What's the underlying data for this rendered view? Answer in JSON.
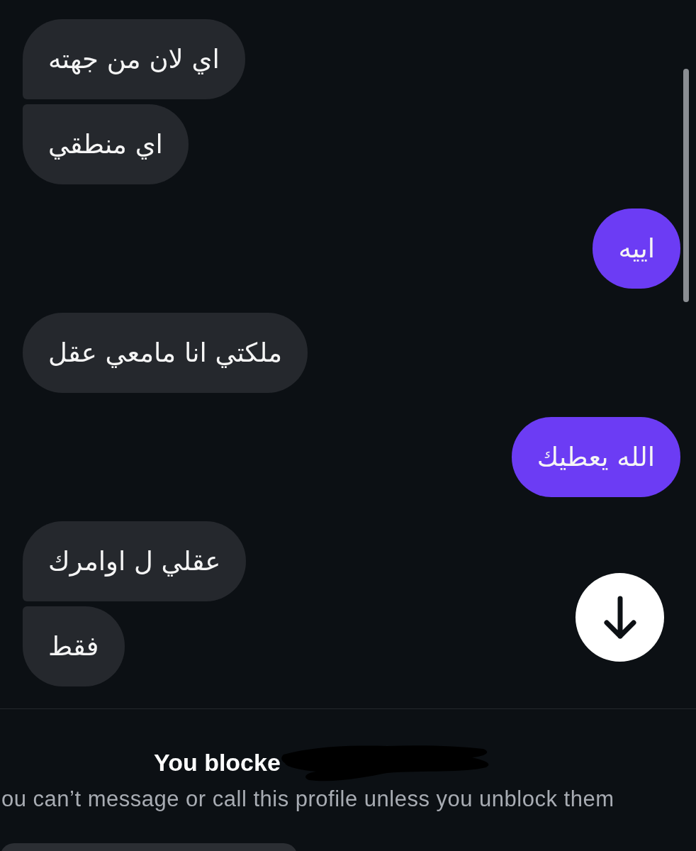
{
  "messages": [
    {
      "kind": "received",
      "text": "اي لان من جهته"
    },
    {
      "kind": "received",
      "text": "اي منطقي"
    },
    {
      "kind": "sent",
      "text": "اييه"
    },
    {
      "kind": "received",
      "text": "ملكتي انا مامعي عقل"
    },
    {
      "kind": "sent",
      "text": "الله يعطيك"
    },
    {
      "kind": "received",
      "text": "عقلي ل اوامرك"
    },
    {
      "kind": "received",
      "text": "فقط"
    }
  ],
  "blocked_notice": {
    "title": "You blocke",
    "subtitle": "ou can’t message or call this profile unless you unblock them"
  }
}
